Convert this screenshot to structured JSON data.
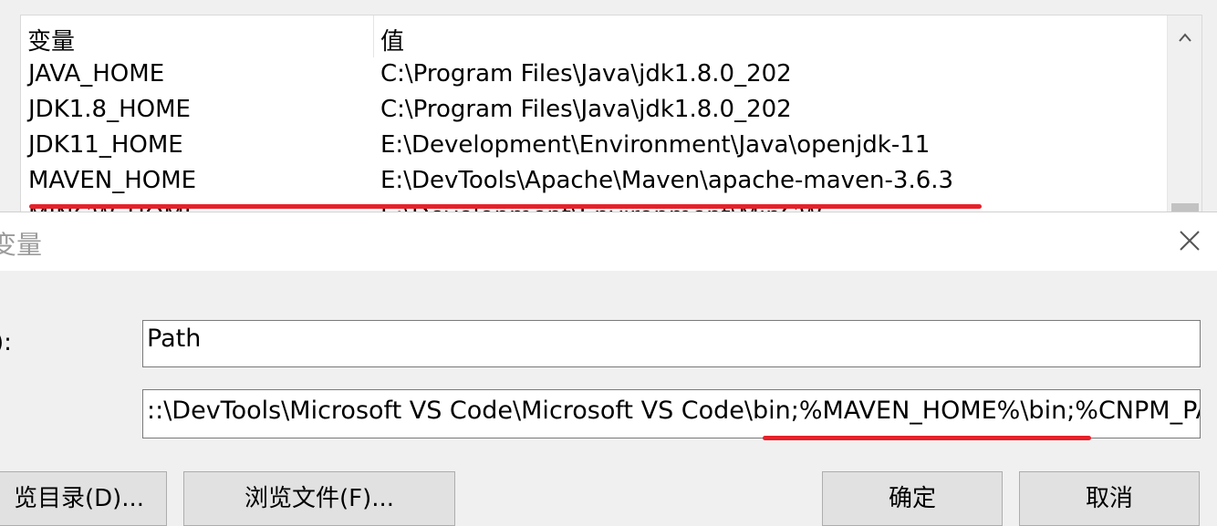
{
  "var_list": {
    "header": {
      "col_variable": "变量",
      "col_value": "值"
    },
    "rows": [
      {
        "name": "JAVA_HOME",
        "value": "C:\\Program Files\\Java\\jdk1.8.0_202"
      },
      {
        "name": "JDK1.8_HOME",
        "value": "C:\\Program Files\\Java\\jdk1.8.0_202"
      },
      {
        "name": "JDK11_HOME",
        "value": "E:\\Development\\Environment\\Java\\openjdk-11"
      },
      {
        "name": "MAVEN_HOME",
        "value": "E:\\DevTools\\Apache\\Maven\\apache-maven-3.6.3"
      },
      {
        "name": "MINGW_HOME",
        "value": "E:\\Development\\Environment\\MinGW"
      }
    ],
    "scroll_up_icon": "chevron-up-icon"
  },
  "dialog": {
    "title": "变量",
    "close_icon": "close-icon",
    "name_label": "):",
    "name_value": "Path",
    "value_label": ":",
    "value_value": "::\\DevTools\\Microsoft VS Code\\Microsoft VS Code\\bin;%MAVEN_HOME%\\bin;%CNPM_PATH%",
    "buttons": {
      "browse_dir": "览目录(D)...",
      "browse_file": "浏览文件(F)...",
      "ok": "确定",
      "cancel": "取消"
    }
  },
  "colors": {
    "highlight_underline": "#e8202a"
  }
}
